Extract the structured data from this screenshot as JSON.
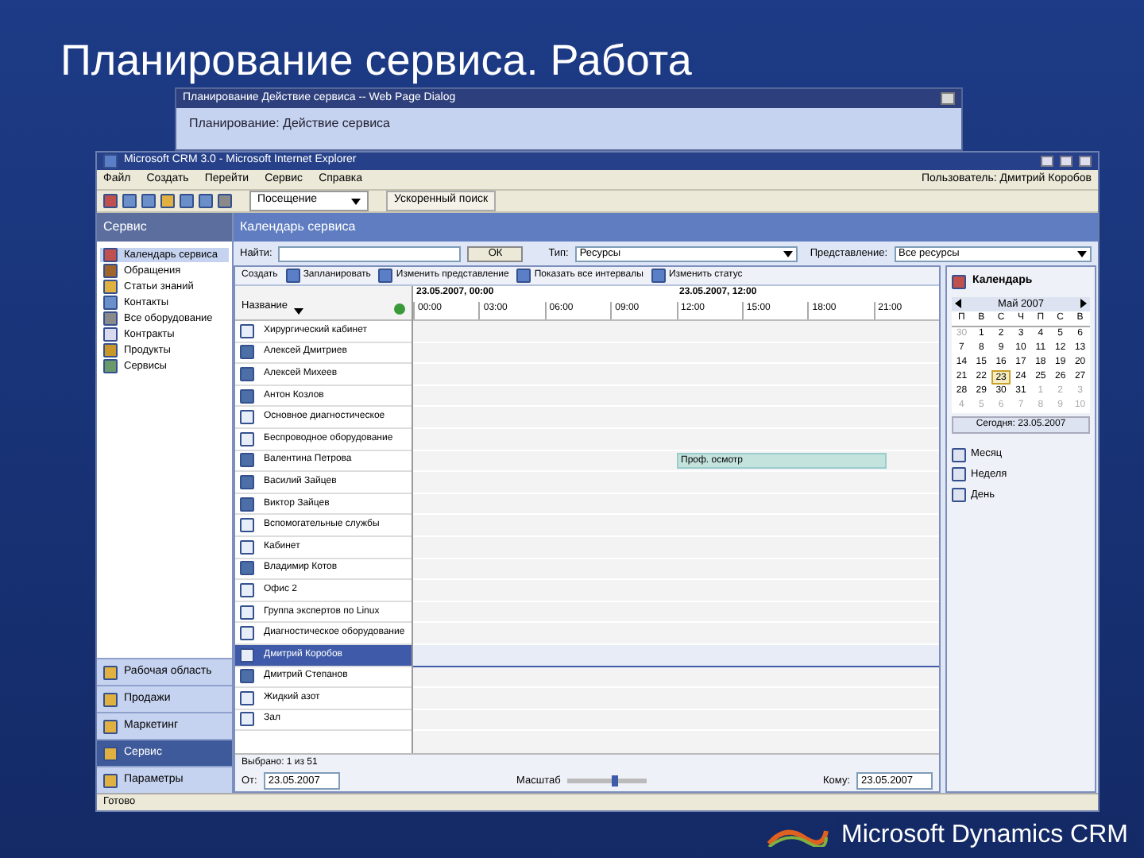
{
  "slide_title": "Планирование сервиса. Работа",
  "dialog": {
    "title": "Планирование Действие сервиса -- Web Page Dialog",
    "heading": "Планирование: Действие сервиса"
  },
  "window": {
    "title": "Microsoft CRM 3.0 - Microsoft Internet Explorer"
  },
  "menu": [
    "Файл",
    "Создать",
    "Перейти",
    "Сервис",
    "Справка"
  ],
  "user": "Пользователь: Дмитрий Коробов",
  "toolbar": {
    "dropdown": "Посещение",
    "button": "Ускоренный поиск"
  },
  "nav": {
    "title": "Сервис",
    "items": [
      {
        "label": "Календарь сервиса",
        "kind": "calendar",
        "selected": true
      },
      {
        "label": "Обращения",
        "kind": "case",
        "selected": false
      },
      {
        "label": "Статьи знаний",
        "kind": "article",
        "selected": false
      },
      {
        "label": "Контакты",
        "kind": "contact",
        "selected": false
      },
      {
        "label": "Все оборудование",
        "kind": "tool",
        "selected": false
      },
      {
        "label": "Контракты",
        "kind": "contract",
        "selected": false
      },
      {
        "label": "Продукты",
        "kind": "product",
        "selected": false
      },
      {
        "label": "Сервисы",
        "kind": "service",
        "selected": false
      }
    ],
    "areas": [
      {
        "label": "Рабочая область",
        "selected": false
      },
      {
        "label": "Продажи",
        "selected": false
      },
      {
        "label": "Маркетинг",
        "selected": false
      },
      {
        "label": "Сервис",
        "selected": true
      },
      {
        "label": "Параметры",
        "selected": false
      }
    ]
  },
  "content_title": "Календарь сервиса",
  "filters": {
    "find_label": "Найти:",
    "find_button": "ОК",
    "type_label": "Тип:",
    "type_value": "Ресурсы",
    "view_label": "Представление:",
    "view_value": "Все ресурсы"
  },
  "actions": [
    "Создать",
    "Запланировать",
    "Изменить представление",
    "Показать все интервалы",
    "Изменить статус"
  ],
  "column": "Название",
  "times": [
    "23.05.2007, 00:00",
    "23.05.2007, 12:00"
  ],
  "ticks": [
    "00:00",
    "03:00",
    "06:00",
    "09:00",
    "12:00",
    "15:00",
    "18:00",
    "21:00"
  ],
  "resources": [
    {
      "name": "Хирургический кабинет",
      "kind": "facility",
      "selected": false
    },
    {
      "name": "Алексей Дмитриев",
      "kind": "user",
      "selected": false
    },
    {
      "name": "Алексей Михеев",
      "kind": "user",
      "selected": false
    },
    {
      "name": "Антон Козлов",
      "kind": "user",
      "selected": false
    },
    {
      "name": "Основное диагностическое",
      "kind": "facility",
      "selected": false
    },
    {
      "name": "Беспроводное оборудование",
      "kind": "facility",
      "selected": false
    },
    {
      "name": "Валентина Петрова",
      "kind": "user",
      "selected": false,
      "event": "Проф. осмотр"
    },
    {
      "name": "Василий Зайцев",
      "kind": "user",
      "selected": false
    },
    {
      "name": "Виктор Зайцев",
      "kind": "user",
      "selected": false
    },
    {
      "name": "Вспомогательные службы",
      "kind": "facility",
      "selected": false
    },
    {
      "name": "Кабинет",
      "kind": "facility",
      "selected": false
    },
    {
      "name": "Владимир Котов",
      "kind": "user",
      "selected": false
    },
    {
      "name": "Офис 2",
      "kind": "facility",
      "selected": false
    },
    {
      "name": "Группа экспертов по Linux",
      "kind": "facility",
      "selected": false
    },
    {
      "name": "Диагностическое оборудование",
      "kind": "facility",
      "selected": false
    },
    {
      "name": "Дмитрий Коробов",
      "kind": "facility",
      "selected": true
    },
    {
      "name": "Дмитрий Степанов",
      "kind": "user",
      "selected": false
    },
    {
      "name": "Жидкий азот",
      "kind": "facility",
      "selected": false
    },
    {
      "name": "Зал",
      "kind": "facility",
      "selected": false
    }
  ],
  "selection": "Выбрано: 1 из 51",
  "footer": {
    "from_label": "От:",
    "from_value": "23.05.2007",
    "to_label": "Кому:",
    "to_value": "23.05.2007",
    "zoom_label": "Масштаб",
    "zoom_slider": {
      "level": 0.6
    }
  },
  "calendar": {
    "title": "Календарь",
    "month": "Май 2007",
    "weekdays": [
      "П",
      "В",
      "С",
      "Ч",
      "П",
      "С",
      "В"
    ],
    "days": [
      {
        "d": "30",
        "muted": true,
        "selected": false
      },
      {
        "d": "1",
        "muted": false,
        "selected": false
      },
      {
        "d": "2",
        "muted": false,
        "selected": false
      },
      {
        "d": "3",
        "muted": false,
        "selected": false
      },
      {
        "d": "4",
        "muted": false,
        "selected": false
      },
      {
        "d": "5",
        "muted": false,
        "selected": false
      },
      {
        "d": "6",
        "muted": false,
        "selected": false
      },
      {
        "d": "7",
        "muted": false,
        "selected": false
      },
      {
        "d": "8",
        "muted": false,
        "selected": false
      },
      {
        "d": "9",
        "muted": false,
        "selected": false
      },
      {
        "d": "10",
        "muted": false,
        "selected": false
      },
      {
        "d": "11",
        "muted": false,
        "selected": false
      },
      {
        "d": "12",
        "muted": false,
        "selected": false
      },
      {
        "d": "13",
        "muted": false,
        "selected": false
      },
      {
        "d": "14",
        "muted": false,
        "selected": false
      },
      {
        "d": "15",
        "muted": false,
        "selected": false
      },
      {
        "d": "16",
        "muted": false,
        "selected": false
      },
      {
        "d": "17",
        "muted": false,
        "selected": false
      },
      {
        "d": "18",
        "muted": false,
        "selected": false
      },
      {
        "d": "19",
        "muted": false,
        "selected": false
      },
      {
        "d": "20",
        "muted": false,
        "selected": false
      },
      {
        "d": "21",
        "muted": false,
        "selected": false
      },
      {
        "d": "22",
        "muted": false,
        "selected": false
      },
      {
        "d": "23",
        "muted": false,
        "selected": true
      },
      {
        "d": "24",
        "muted": false,
        "selected": false
      },
      {
        "d": "25",
        "muted": false,
        "selected": false
      },
      {
        "d": "26",
        "muted": false,
        "selected": false
      },
      {
        "d": "27",
        "muted": false,
        "selected": false
      },
      {
        "d": "28",
        "muted": false,
        "selected": false
      },
      {
        "d": "29",
        "muted": false,
        "selected": false
      },
      {
        "d": "30",
        "muted": false,
        "selected": false
      },
      {
        "d": "31",
        "muted": false,
        "selected": false
      },
      {
        "d": "1",
        "muted": true,
        "selected": false
      },
      {
        "d": "2",
        "muted": true,
        "selected": false
      },
      {
        "d": "3",
        "muted": true,
        "selected": false
      },
      {
        "d": "4",
        "muted": true,
        "selected": false
      },
      {
        "d": "5",
        "muted": true,
        "selected": false
      },
      {
        "d": "6",
        "muted": true,
        "selected": false
      },
      {
        "d": "7",
        "muted": true,
        "selected": false
      },
      {
        "d": "8",
        "muted": true,
        "selected": false
      },
      {
        "d": "9",
        "muted": true,
        "selected": false
      },
      {
        "d": "10",
        "muted": true,
        "selected": false
      }
    ],
    "today": "Сегодня: 23.05.2007",
    "views": [
      "Месяц",
      "Неделя",
      "День"
    ]
  },
  "status": "Готово",
  "logo": "Microsoft Dynamics CRM"
}
